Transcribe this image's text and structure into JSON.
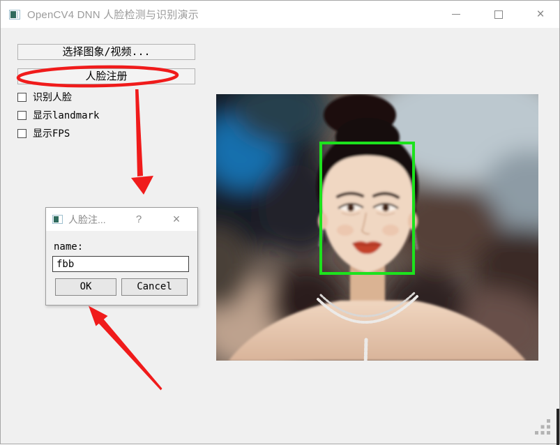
{
  "window": {
    "title": "OpenCV4 DNN 人脸检测与识别演示"
  },
  "icons": {
    "close_glyph": "×",
    "help_glyph": "?"
  },
  "controls_panel": {
    "select_media_button": "选择图象/视频...",
    "face_register_button": "人脸注册",
    "checkboxes": [
      {
        "label": "识别人脸",
        "checked": false
      },
      {
        "label": "显示landmark",
        "checked": false
      },
      {
        "label": "显示FPS",
        "checked": false
      }
    ]
  },
  "dialog": {
    "title": "人脸注...",
    "name_label": "name:",
    "input_value": "fbb",
    "ok_label": "OK",
    "cancel_label": "Cancel"
  },
  "image_panel": {
    "photo_alt": "portrait photo with detected face",
    "face_box_color": "#1de21d"
  },
  "annotations": {
    "color": "#f01b1b"
  }
}
